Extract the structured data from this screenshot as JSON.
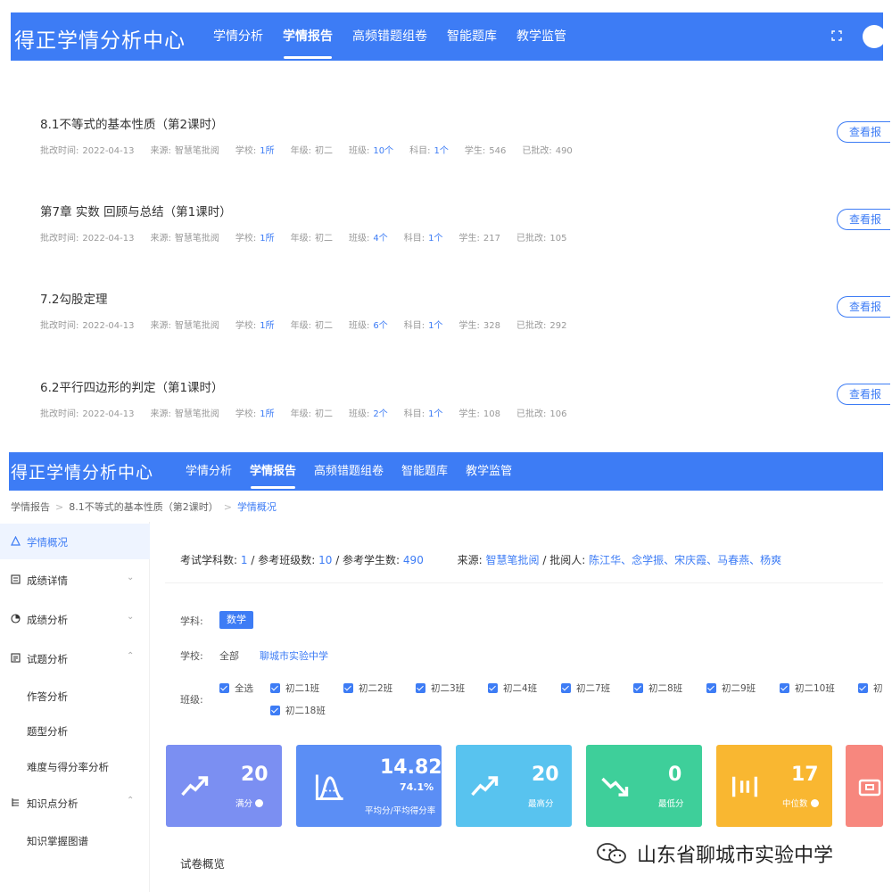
{
  "header": {
    "brand": "得正学情分析中心",
    "nav": [
      "学情分析",
      "学情报告",
      "高频错题组卷",
      "智能题库",
      "教学监管"
    ],
    "active_index": 1,
    "icons": [
      "fullscreen-icon",
      "avatar"
    ]
  },
  "reports": [
    {
      "title": "8.1不等式的基本性质（第2课时）",
      "time_label": "批改时间:",
      "time": "2022-04-13",
      "source_label": "来源:",
      "source": "智慧笔批阅",
      "school_label": "学校:",
      "school": "1所",
      "grade_label": "年级:",
      "grade": "初二",
      "class_label": "班级:",
      "class": "10个",
      "subject_label": "科目:",
      "subject": "1个",
      "students_label": "学生:",
      "students": "546",
      "graded_label": "已批改:",
      "graded": "490",
      "button": "查看报"
    },
    {
      "title": "第7章 实数 回顾与总结（第1课时）",
      "time_label": "批改时间:",
      "time": "2022-04-13",
      "source_label": "来源:",
      "source": "智慧笔批阅",
      "school_label": "学校:",
      "school": "1所",
      "grade_label": "年级:",
      "grade": "初二",
      "class_label": "班级:",
      "class": "4个",
      "subject_label": "科目:",
      "subject": "1个",
      "students_label": "学生:",
      "students": "217",
      "graded_label": "已批改:",
      "graded": "105",
      "button": "查看报"
    },
    {
      "title": "7.2勾股定理",
      "time_label": "批改时间:",
      "time": "2022-04-13",
      "source_label": "来源:",
      "source": "智慧笔批阅",
      "school_label": "学校:",
      "school": "1所",
      "grade_label": "年级:",
      "grade": "初二",
      "class_label": "班级:",
      "class": "6个",
      "subject_label": "科目:",
      "subject": "1个",
      "students_label": "学生:",
      "students": "328",
      "graded_label": "已批改:",
      "graded": "292",
      "button": "查看报"
    },
    {
      "title": "6.2平行四边形的判定（第1课时）",
      "time_label": "批改时间:",
      "time": "2022-04-13",
      "source_label": "来源:",
      "source": "智慧笔批阅",
      "school_label": "学校:",
      "school": "1所",
      "grade_label": "年级:",
      "grade": "初二",
      "class_label": "班级:",
      "class": "2个",
      "subject_label": "科目:",
      "subject": "1个",
      "students_label": "学生:",
      "students": "108",
      "graded_label": "已批改:",
      "graded": "106",
      "button": "查看报"
    }
  ],
  "breadcrumb": [
    "学情报告",
    "8.1不等式的基本性质（第2课时）",
    "学情概况"
  ],
  "sidebar": {
    "items": [
      "学情概况",
      "成绩详情",
      "成绩分析",
      "试题分析",
      "知识点分析"
    ],
    "sub_items": [
      "作答分析",
      "题型分析",
      "难度与得分率分析",
      "知识掌握图谱"
    ]
  },
  "summary": {
    "subjects_label": "考试学科数:",
    "subjects": "1",
    "classes_label": "/ 参考班级数:",
    "classes": "10",
    "students_label": "/ 参考学生数:",
    "students": "490",
    "source_label": "来源:",
    "source": "智慧笔批阅",
    "graders_label": "/ 批阅人:",
    "graders": "陈江华、念学振、宋庆霞、马春燕、杨爽"
  },
  "filters": {
    "subject_label": "学科:",
    "subject": "数学",
    "school_label": "学校:",
    "school_all": "全部",
    "school": "聊城市实验中学",
    "class_label": "班级:",
    "classes": [
      "全选",
      "初二1班",
      "初二2班",
      "初二3班",
      "初二4班",
      "初二7班",
      "初二8班",
      "初二9班",
      "初二10班",
      "初",
      "初二18班"
    ]
  },
  "stats": [
    {
      "value": "20",
      "label": "满分",
      "color": "#7b8ff2",
      "icon": "trend-up-icon"
    },
    {
      "value": "14.82",
      "pct": "74.1%",
      "label": "平均分/平均得分率",
      "color": "#5b8ef5",
      "icon": "bell-curve-icon"
    },
    {
      "value": "20",
      "label": "最高分",
      "color": "#58c3ef",
      "icon": "trend-up-icon"
    },
    {
      "value": "0",
      "label": "最低分",
      "color": "#3ecf9a",
      "icon": "trend-down-icon"
    },
    {
      "value": "17",
      "label": "中位数",
      "color": "#f9b731",
      "icon": "median-icon"
    }
  ],
  "overview_title": "试卷概览",
  "watermark": "山东省聊城市实验中学"
}
